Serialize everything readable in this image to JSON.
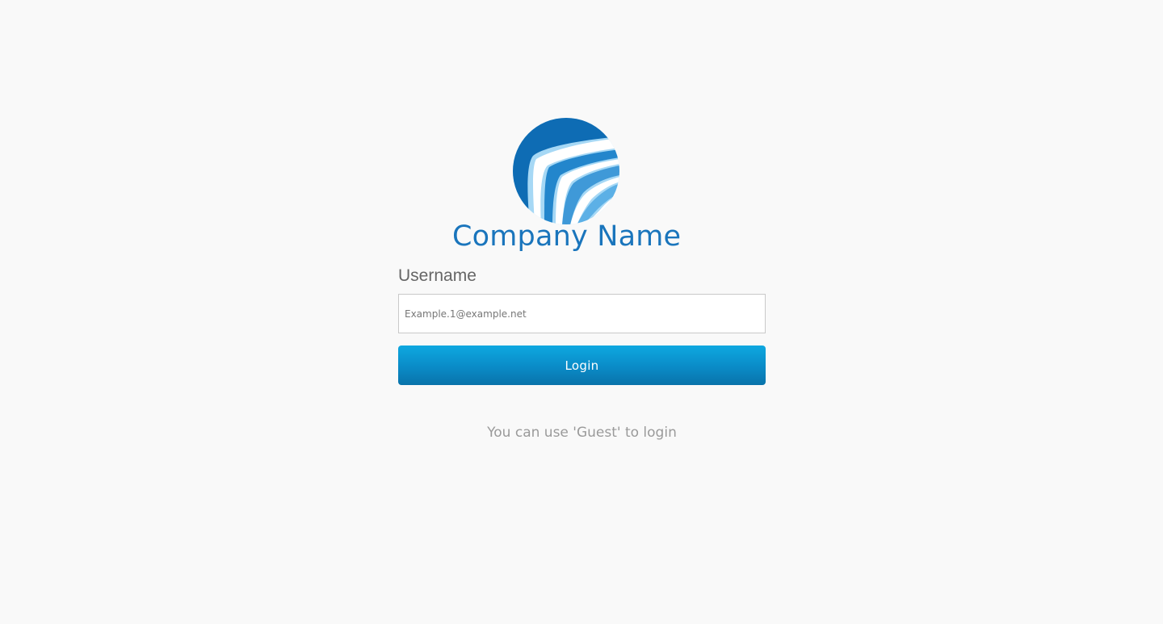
{
  "brand": {
    "name": "Company Name",
    "logo_icon": "company-logo-icon",
    "colors": {
      "primary": "#1a75bc",
      "light": "#a6d8f5",
      "mid": "#4aa3dc"
    }
  },
  "login_form": {
    "username_label": "Username",
    "username_placeholder": "Example.1@example.net",
    "username_value": "",
    "login_button_label": "Login",
    "button_color": "#0a8bc7"
  },
  "hint": "You can use 'Guest' to login"
}
